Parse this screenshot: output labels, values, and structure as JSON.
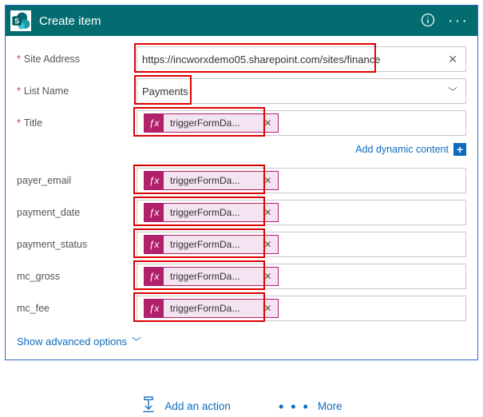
{
  "header": {
    "title": "Create item"
  },
  "siteAddress": {
    "label": "Site Address",
    "value": "https://incworxdemo05.sharepoint.com/sites/finance"
  },
  "listName": {
    "label": "List Name",
    "value": "Payments"
  },
  "title": {
    "label": "Title"
  },
  "dynamic": {
    "label": "Add dynamic content"
  },
  "tokenLabel": "triggerFormDa...",
  "fields": {
    "payer_email": {
      "label": "payer_email"
    },
    "payment_date": {
      "label": "payment_date"
    },
    "payment_status": {
      "label": "payment_status"
    },
    "mc_gross": {
      "label": "mc_gross"
    },
    "mc_fee": {
      "label": "mc_fee"
    }
  },
  "advanced": {
    "label": "Show advanced options"
  },
  "footer": {
    "addAction": "Add an action",
    "more": "More"
  }
}
